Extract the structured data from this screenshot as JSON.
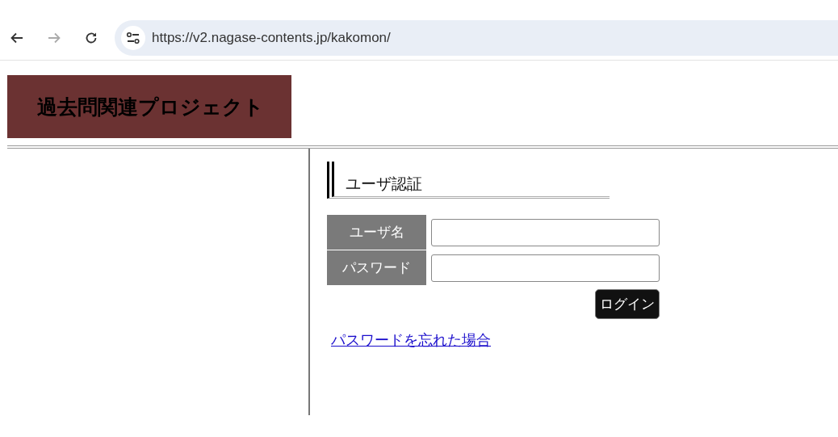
{
  "browser": {
    "nav_buttons": [
      {
        "kind": "back",
        "disabled": false
      },
      {
        "kind": "forward",
        "disabled": true
      },
      {
        "kind": "reload",
        "disabled": false
      }
    ],
    "url": "https://v2.nagase-contents.jp/kakomon/"
  },
  "header": {
    "logo_text": "過去問関連プロジェクト"
  },
  "login": {
    "title": "ユーザ認証",
    "fields": [
      {
        "label": "ユーザ名"
      },
      {
        "label": "パスワード"
      }
    ],
    "submit": "ログイン",
    "forgot_link": "パスワードを忘れた場合"
  }
}
